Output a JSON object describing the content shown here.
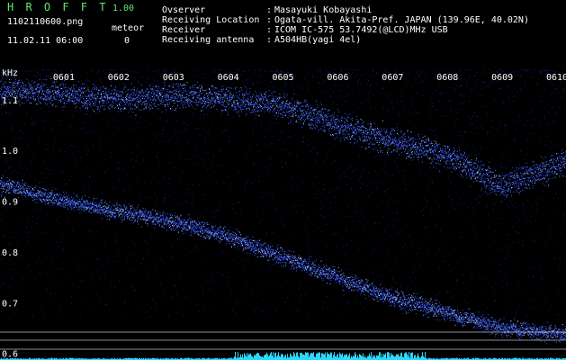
{
  "app": {
    "title": "H R O F F T",
    "version": "1.00",
    "file_name": "1102110600.png",
    "datetime": "11.02.11 06:00",
    "meteor_label": "meteor",
    "meteor_count": "0"
  },
  "info": [
    {
      "label": "Ovserver",
      "value": "Masayuki Kobayashi"
    },
    {
      "label": "Receiving Location",
      "value": "Ogata-vill. Akita-Pref. JAPAN (139.96E, 40.02N)"
    },
    {
      "label": "Receiver",
      "value": "ICOM IC-575 53.7492(@LCD)MHz USB"
    },
    {
      "label": "Receiving antenna",
      "value": "A504HB(yagi 4el)"
    }
  ],
  "colon": ":",
  "spectrogram": {
    "y_unit": "kHz",
    "y_ticks": [
      "1.1",
      "1.0",
      "0.9",
      "0.8",
      "0.7",
      "0.6"
    ],
    "x_ticks": [
      "0601",
      "0602",
      "0603",
      "0604",
      "0605",
      "0606",
      "0607",
      "0608",
      "0609",
      "0610"
    ],
    "colors": {
      "background": "#000000",
      "signal": "#3a5cff",
      "signal_bright": "#9fc0ff",
      "noise": "#101a7a",
      "level": "#2ad8ff",
      "grid": "#ffffff"
    },
    "trace_upper": {
      "x_minutes": [
        0,
        1,
        2,
        3,
        4,
        5,
        6,
        7,
        8,
        9,
        10
      ],
      "khz": [
        1.12,
        1.11,
        1.1,
        1.11,
        1.1,
        1.09,
        1.05,
        1.02,
        0.99,
        0.93,
        0.97
      ]
    },
    "trace_lower": {
      "x_minutes": [
        0,
        1,
        2,
        3,
        4,
        5,
        6,
        7,
        8,
        9,
        10
      ],
      "khz": [
        0.93,
        0.9,
        0.88,
        0.86,
        0.83,
        0.79,
        0.75,
        0.71,
        0.68,
        0.65,
        0.64
      ]
    }
  }
}
